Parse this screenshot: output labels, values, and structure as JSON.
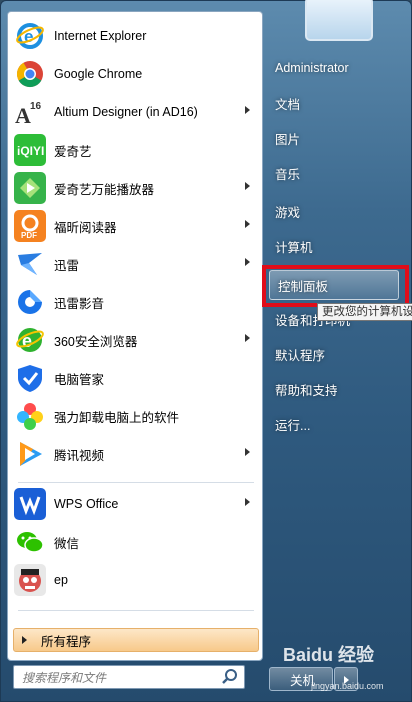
{
  "programs": [
    {
      "label": "Internet Explorer",
      "icon": "internet-explorer-icon",
      "submenu": false
    },
    {
      "label": "Google Chrome",
      "icon": "google-chrome-icon",
      "submenu": false
    },
    {
      "label": "Altium Designer (in AD16)",
      "icon": "altium-designer-icon",
      "submenu": true
    },
    {
      "label": "爱奇艺",
      "icon": "iqiyi-icon",
      "submenu": false
    },
    {
      "label": "爱奇艺万能播放器",
      "icon": "iqiyi-player-icon",
      "submenu": true
    },
    {
      "label": "福昕阅读器",
      "icon": "foxit-reader-icon",
      "submenu": true
    },
    {
      "label": "迅雷",
      "icon": "xunlei-icon",
      "submenu": true
    },
    {
      "label": "迅雷影音",
      "icon": "xunlei-player-icon",
      "submenu": false
    },
    {
      "label": "360安全浏览器",
      "icon": "360-browser-icon",
      "submenu": true
    },
    {
      "label": "电脑管家",
      "icon": "pc-manager-icon",
      "submenu": false
    },
    {
      "label": "强力卸载电脑上的软件",
      "icon": "uninstaller-icon",
      "submenu": false
    },
    {
      "label": "腾讯视频",
      "icon": "tencent-video-icon",
      "submenu": true
    },
    {
      "label": "WPS Office",
      "icon": "wps-office-icon",
      "submenu": true
    },
    {
      "label": "微信",
      "icon": "wechat-icon",
      "submenu": false
    },
    {
      "label": "ep",
      "icon": "ep-icon",
      "submenu": false
    }
  ],
  "all_programs_label": "所有程序",
  "search": {
    "placeholder": "搜索程序和文件"
  },
  "right_items": [
    {
      "label": "Administrator"
    },
    {
      "label": "文档"
    },
    {
      "label": "图片"
    },
    {
      "label": "音乐"
    },
    {
      "label": "游戏"
    },
    {
      "label": "计算机"
    },
    {
      "label": "控制面板"
    },
    {
      "label": "设备和打印机"
    },
    {
      "label": "默认程序"
    },
    {
      "label": "帮助和支持"
    },
    {
      "label": "运行..."
    }
  ],
  "tooltip": "更改您的计算机设",
  "shutdown_label": "关机",
  "watermark": {
    "main": "Baidu 经验",
    "sub": "jingyan.baidu.com"
  },
  "colors": {
    "highlight_box": "#e00d1a",
    "all_programs_bg": "#f7c98a"
  }
}
